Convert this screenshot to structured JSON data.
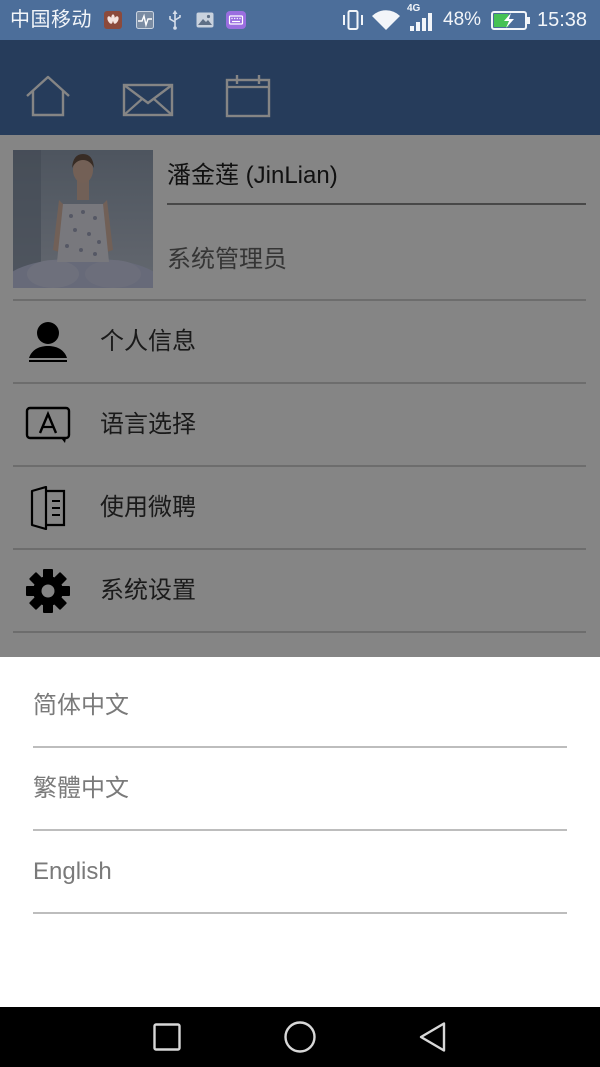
{
  "status_bar": {
    "carrier": "中国移动",
    "notification_icons": [
      "huawei-app-icon",
      "health-monitor-icon",
      "usb-icon",
      "gallery-image-icon",
      "keyboard-icon"
    ],
    "right_icons": [
      "vibrate-icon",
      "wifi-icon",
      "signal-icon",
      "battery-charging-icon"
    ],
    "network_type": "4G",
    "battery_text": "48%",
    "battery_level": 0.48,
    "time": "15:38"
  },
  "header": {
    "icons": [
      "home-icon",
      "mail-icon",
      "calendar-icon"
    ]
  },
  "profile": {
    "name": "潘金莲 (JinLian)",
    "role": "系统管理员"
  },
  "menu": {
    "items": [
      {
        "label": "个人信息",
        "icon": "person-icon"
      },
      {
        "label": "语言选择",
        "icon": "language-icon"
      },
      {
        "label": "使用微聘",
        "icon": "guide-book-icon"
      },
      {
        "label": "系统设置",
        "icon": "gear-icon"
      }
    ]
  },
  "language_dialog": {
    "options": [
      "简体中文",
      "繁體中文",
      "English"
    ]
  },
  "nav_bar": {
    "icons": [
      "recent-apps-icon",
      "home-button-icon",
      "back-icon"
    ]
  },
  "colors": {
    "status_bar": "#4c6e9a",
    "header": "#4a74ae",
    "battery_fill": "#46c254",
    "sheet_text": "#7a7a7a",
    "scrim": "#000000"
  }
}
